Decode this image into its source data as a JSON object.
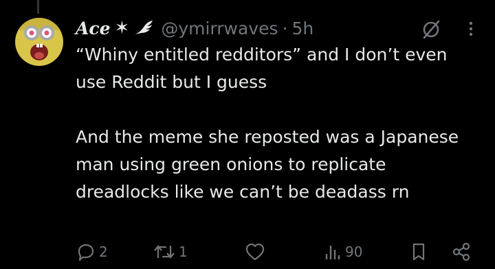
{
  "tweet": {
    "display_name": "Ace",
    "handle": "@ymirrwaves",
    "separator": "·",
    "time": "5h",
    "text": "“Whiny entitled redditors” and I don’t even use Reddit but I guess\n\nAnd the meme she reposted was a Japanese man using green onions to replicate dreadlocks like we can’t be deadass rn",
    "icons": [
      "star-icon",
      "wing-icon",
      "grok-icon",
      "more-icon"
    ]
  },
  "actions": {
    "reply_count": "2",
    "repost_count": "1",
    "like_count": "",
    "view_count": "90",
    "icons": [
      "reply-icon",
      "repost-icon",
      "like-icon",
      "views-icon",
      "bookmark-icon",
      "share-icon"
    ]
  },
  "colors": {
    "background": "#000000",
    "text": "#e7e9ea",
    "muted": "#71767b"
  }
}
